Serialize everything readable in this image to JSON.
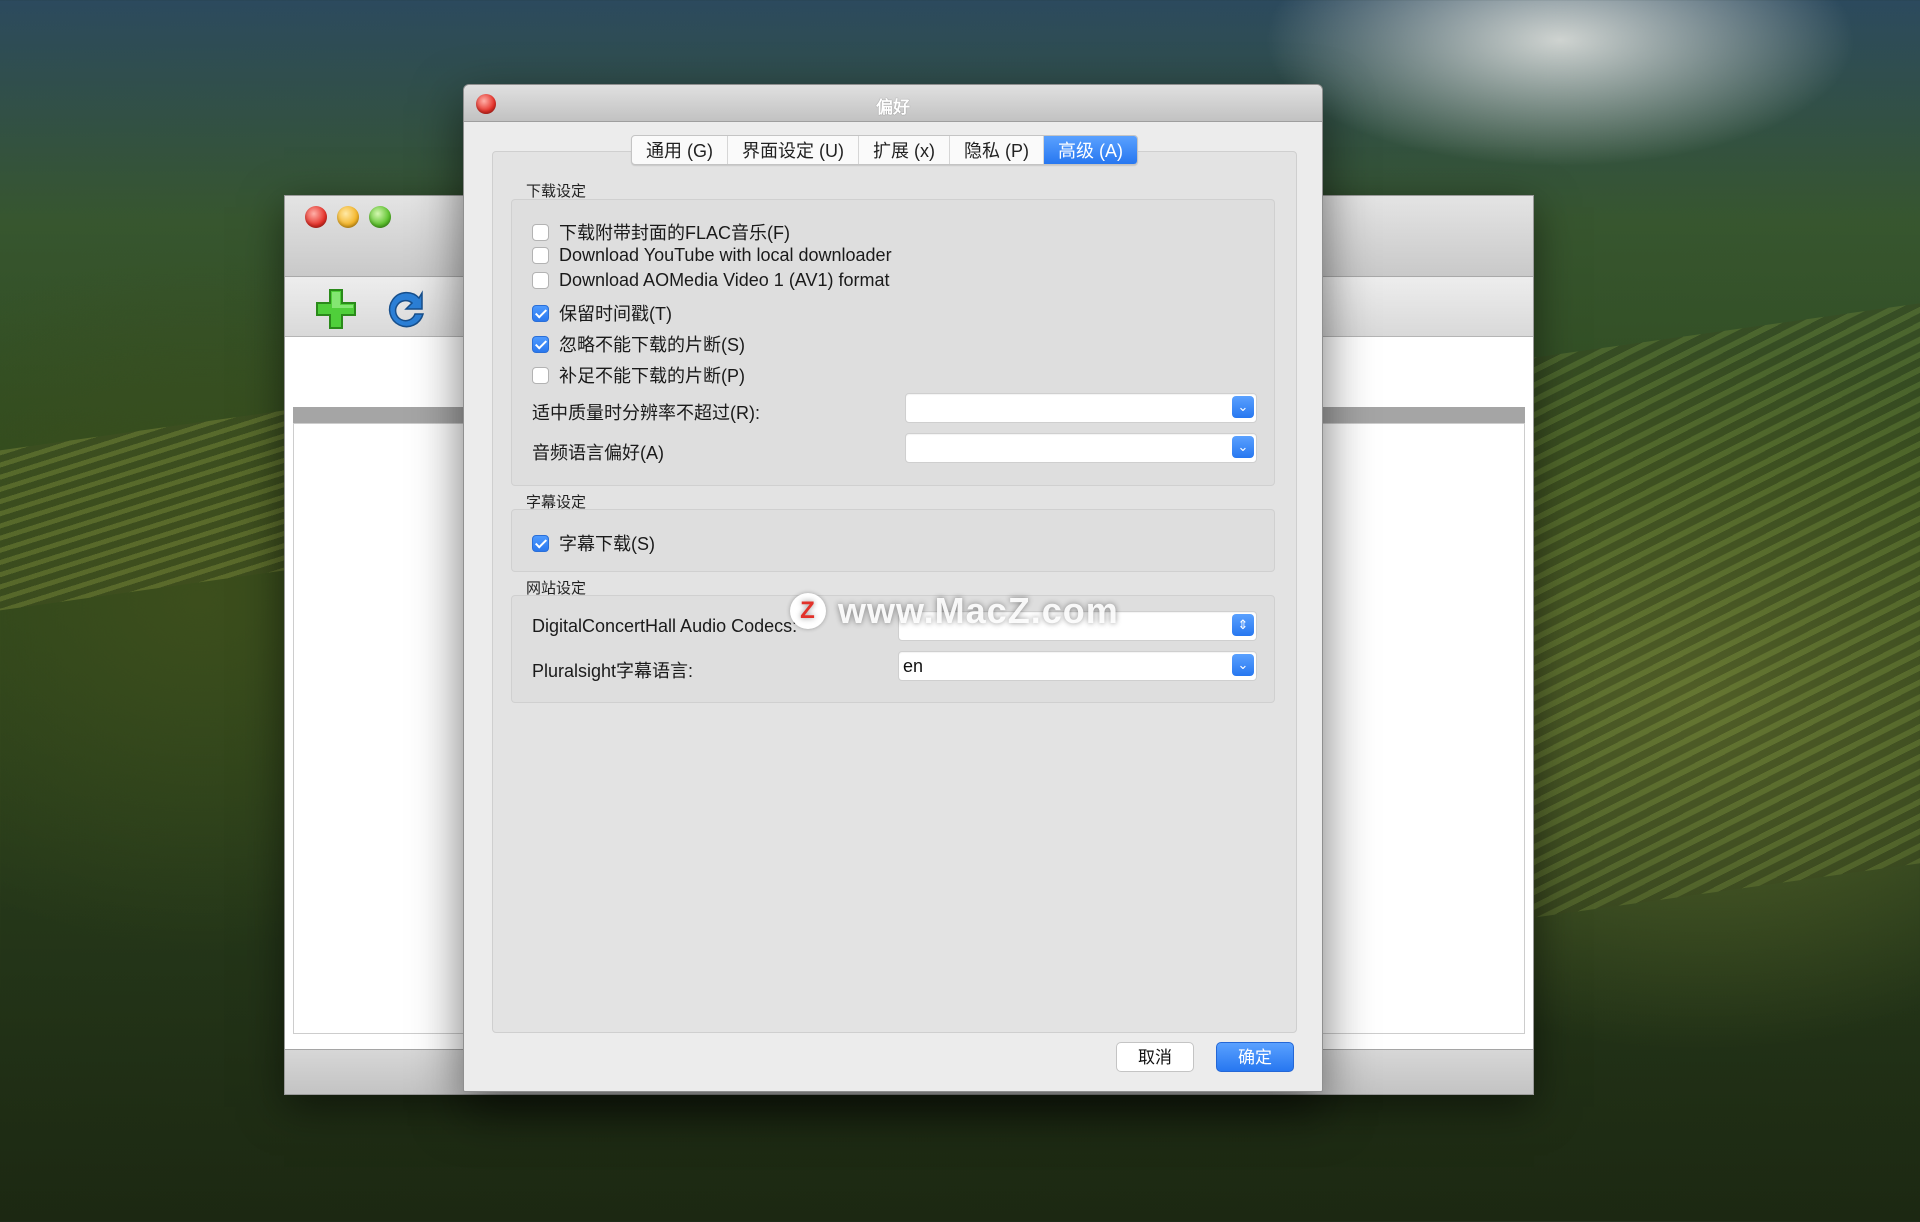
{
  "dialog": {
    "title": "偏好",
    "tabs": [
      {
        "label": "通用 (G)",
        "active": false
      },
      {
        "label": "界面设定 (U)",
        "active": false
      },
      {
        "label": "扩展 (x)",
        "active": false
      },
      {
        "label": "隐私 (P)",
        "active": false
      },
      {
        "label": "高级 (A)",
        "active": true
      }
    ],
    "download_group": {
      "title": "下载设定",
      "checkboxes": [
        {
          "label": "下载附带封面的FLAC音乐(F)",
          "checked": false
        },
        {
          "label": "Download YouTube with local downloader",
          "checked": false
        },
        {
          "label": "Download AOMedia Video 1 (AV1) format",
          "checked": false
        },
        {
          "label": "保留时间戳(T)",
          "checked": true
        },
        {
          "label": "忽略不能下载的片断(S)",
          "checked": true
        },
        {
          "label": "补足不能下载的片断(P)",
          "checked": false
        }
      ],
      "resolution_label": "适中质量时分辨率不超过(R):",
      "resolution_value": "",
      "audio_label": "音频语言偏好(A)",
      "audio_value": ""
    },
    "subtitle_group": {
      "title": "字幕设定",
      "checkbox": {
        "label": "字幕下载(S)",
        "checked": true
      }
    },
    "site_group": {
      "title": "网站设定",
      "dch_label": "DigitalConcertHall Audio Codecs:",
      "dch_value": "",
      "pluralsight_label": "Pluralsight字幕语言:",
      "pluralsight_value": "en"
    },
    "cancel_label": "取消",
    "ok_label": "确定"
  },
  "watermark": {
    "logo": "Z",
    "text": "www.MacZ.com"
  },
  "icons": {
    "select_arrow": "chevron-down-icon",
    "stepper": "up-down-icon",
    "add": "add-icon",
    "refresh": "refresh-icon"
  },
  "colors": {
    "accent": "#2a78ee",
    "close_red": "#e5322a"
  }
}
